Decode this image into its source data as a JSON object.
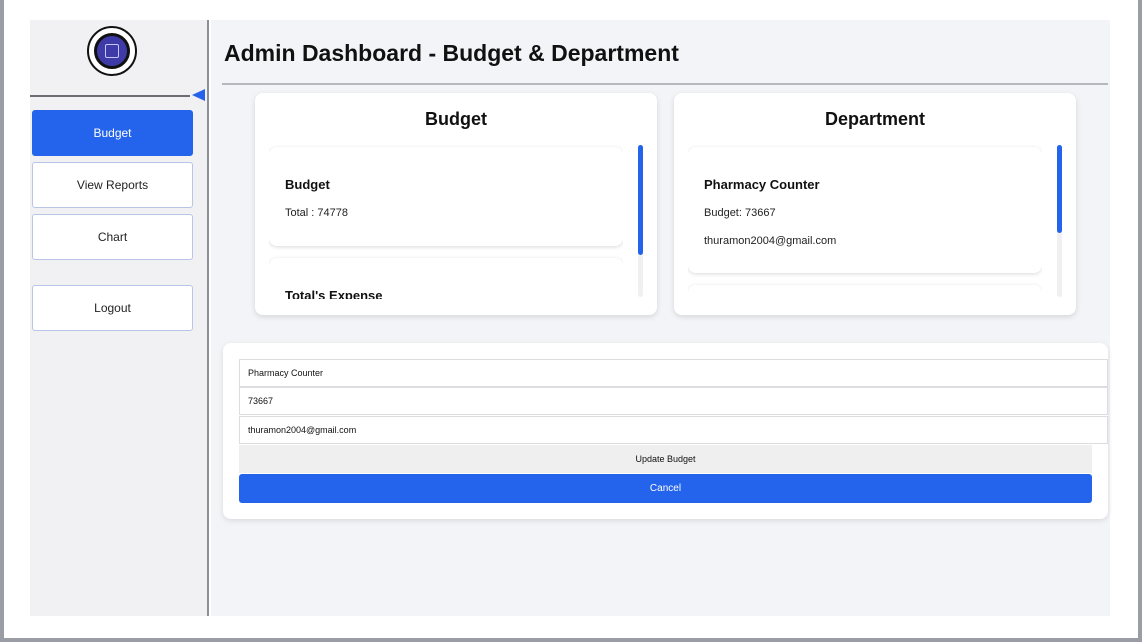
{
  "page": {
    "title": "Admin Dashboard - Budget & Department"
  },
  "sidebar": {
    "logo": "app-logo",
    "items": [
      {
        "label": "Budget",
        "active": true
      },
      {
        "label": "View Reports",
        "active": false
      },
      {
        "label": "Chart",
        "active": false
      },
      {
        "label": "Logout",
        "active": false
      }
    ]
  },
  "budget_card": {
    "title": "Budget",
    "items": [
      {
        "title": "Budget",
        "line1": "Total : 74778"
      },
      {
        "title": "Total's Expense"
      }
    ]
  },
  "department_card": {
    "title": "Department",
    "items": [
      {
        "title": "Pharmacy Counter",
        "budget": "Budget: 73667",
        "email": "thuramon2004@gmail.com"
      }
    ]
  },
  "form": {
    "department": "Pharmacy Counter",
    "budget": "73667",
    "email": "thuramon2004@gmail.com",
    "update_label": "Update Budget",
    "cancel_label": "Cancel"
  },
  "colors": {
    "accent": "#2463eb",
    "background": "#f3f4f7"
  }
}
